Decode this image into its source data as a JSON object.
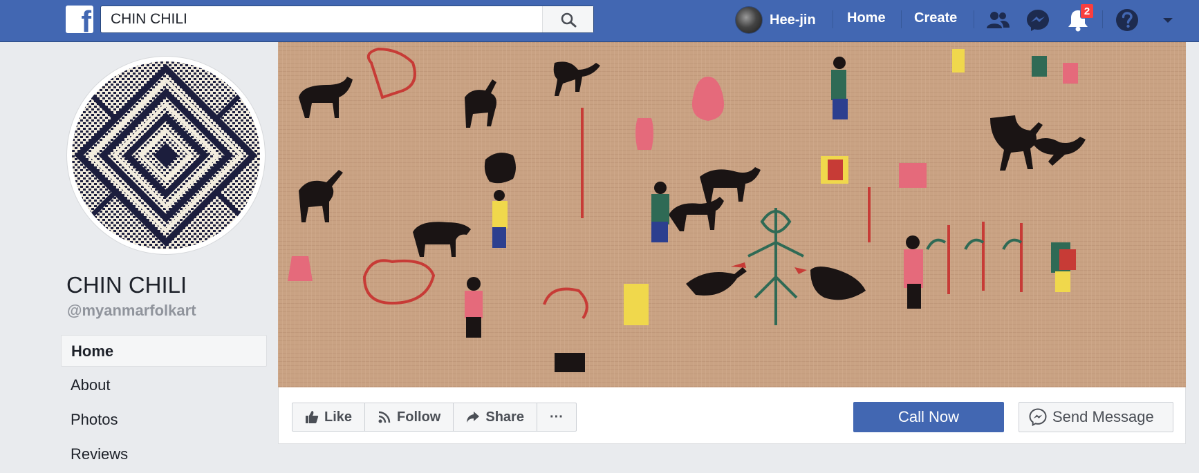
{
  "topbar": {
    "search_value": "CHIN CHILI",
    "user_name": "Hee-jin",
    "nav_home": "Home",
    "nav_create": "Create",
    "notifications_count": "2",
    "icons": [
      "facebook-logo-icon",
      "search-icon",
      "friends-icon",
      "messenger-icon",
      "bell-icon",
      "help-icon",
      "caret-down-icon"
    ]
  },
  "page": {
    "name": "CHIN CHILI",
    "handle": "@myanmarfolkart"
  },
  "sidebar": {
    "items": [
      {
        "label": "Home",
        "active": true
      },
      {
        "label": "About",
        "active": false
      },
      {
        "label": "Photos",
        "active": false
      },
      {
        "label": "Reviews",
        "active": false
      }
    ]
  },
  "actions": {
    "like": "Like",
    "follow": "Follow",
    "share": "Share",
    "more": "···",
    "call_now": "Call Now",
    "send_message": "Send Message"
  },
  "colors": {
    "brand": "#4267b2",
    "badge": "#fa3e3e",
    "cover_bg": "#c8a180"
  }
}
